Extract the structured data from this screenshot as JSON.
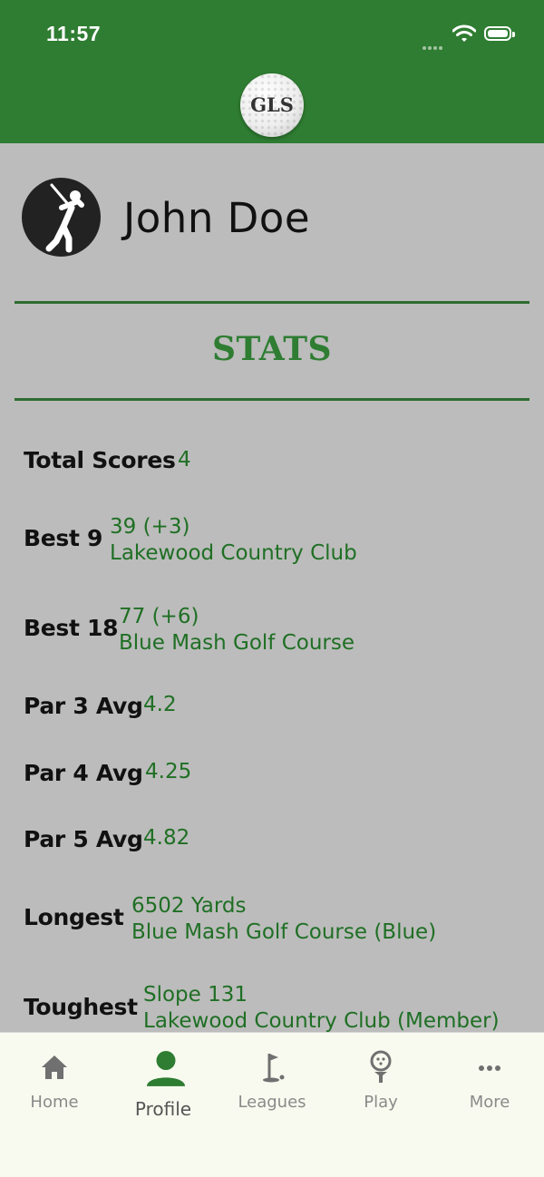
{
  "status_bar": {
    "time": "11:57"
  },
  "header": {
    "logo_text": "GLS"
  },
  "profile": {
    "name": "John Doe",
    "avatar_icon": "golfer-icon"
  },
  "stats": {
    "title": "STATS",
    "items": [
      {
        "label": "Total Scores",
        "value": "4",
        "detail": ""
      },
      {
        "label": "Best 9",
        "value": "39 (+3)",
        "detail": "Lakewood Country Club"
      },
      {
        "label": "Best 18",
        "value": "77 (+6)",
        "detail": "Blue Mash Golf Course"
      },
      {
        "label": "Par 3 Avg",
        "value": "4.2",
        "detail": ""
      },
      {
        "label": "Par 4 Avg",
        "value": "4.25",
        "detail": ""
      },
      {
        "label": "Par 5 Avg",
        "value": "4.82",
        "detail": ""
      },
      {
        "label": "Longest",
        "value": "6502 Yards",
        "detail": "Blue Mash Golf Course (Blue)"
      },
      {
        "label": "Toughest",
        "value": "Slope 131",
        "detail": "Lakewood Country Club (Member)"
      }
    ]
  },
  "tabbar": {
    "active": "Profile",
    "tabs": [
      {
        "label": "Home",
        "icon": "home-icon"
      },
      {
        "label": "Profile",
        "icon": "person-icon"
      },
      {
        "label": "Leagues",
        "icon": "flag-icon"
      },
      {
        "label": "Play",
        "icon": "golf-ball-tee-icon"
      },
      {
        "label": "More",
        "icon": "more-dots-icon"
      }
    ]
  },
  "colors": {
    "header_green": "#2f7d32",
    "accent_green": "#2e7d32",
    "value_green": "#1f6f24",
    "background_gray": "#bcbcbc",
    "tabbar_bg": "#f8faef"
  }
}
